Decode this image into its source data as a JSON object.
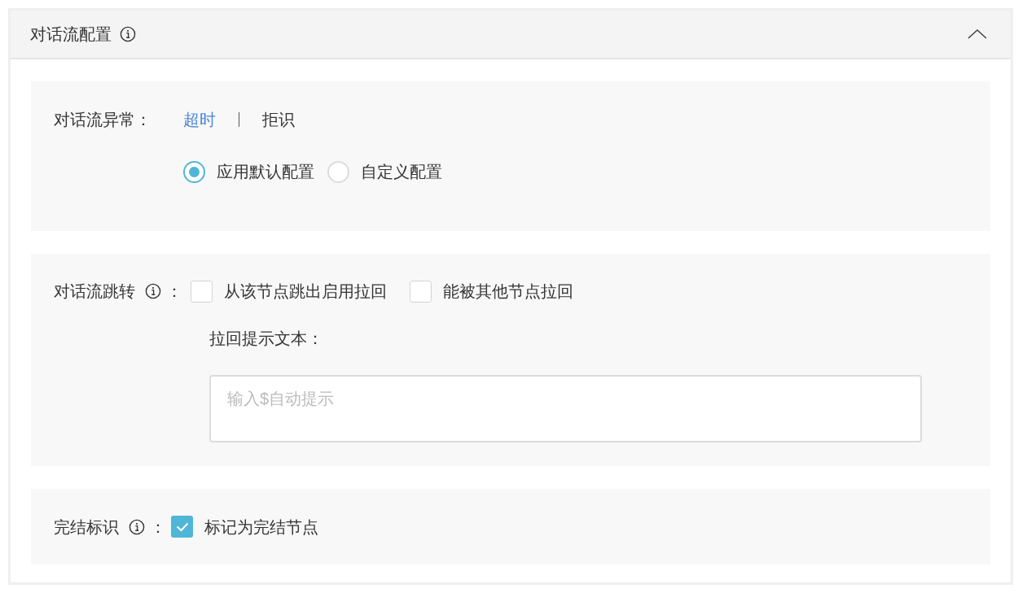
{
  "panel": {
    "title": "对话流配置",
    "expanded": true
  },
  "exception": {
    "label": "对话流异常：",
    "tabs": [
      {
        "label": "超时",
        "selected": true
      },
      {
        "label": "拒识",
        "selected": false
      }
    ],
    "options": [
      {
        "label": "应用默认配置",
        "selected": true
      },
      {
        "label": "自定义配置",
        "selected": false
      }
    ]
  },
  "jump": {
    "label": "对话流跳转",
    "colon": "：",
    "checkboxes": [
      {
        "label": "从该节点跳出启用拉回",
        "checked": false
      },
      {
        "label": "能被其他节点拉回",
        "checked": false
      }
    ],
    "prompt_label": "拉回提示文本：",
    "prompt": {
      "placeholder": "输入$自动提示"
    }
  },
  "finish": {
    "label": "完结标识",
    "colon": "：",
    "checkbox": {
      "label": "标记为完结节点",
      "checked": true
    }
  }
}
